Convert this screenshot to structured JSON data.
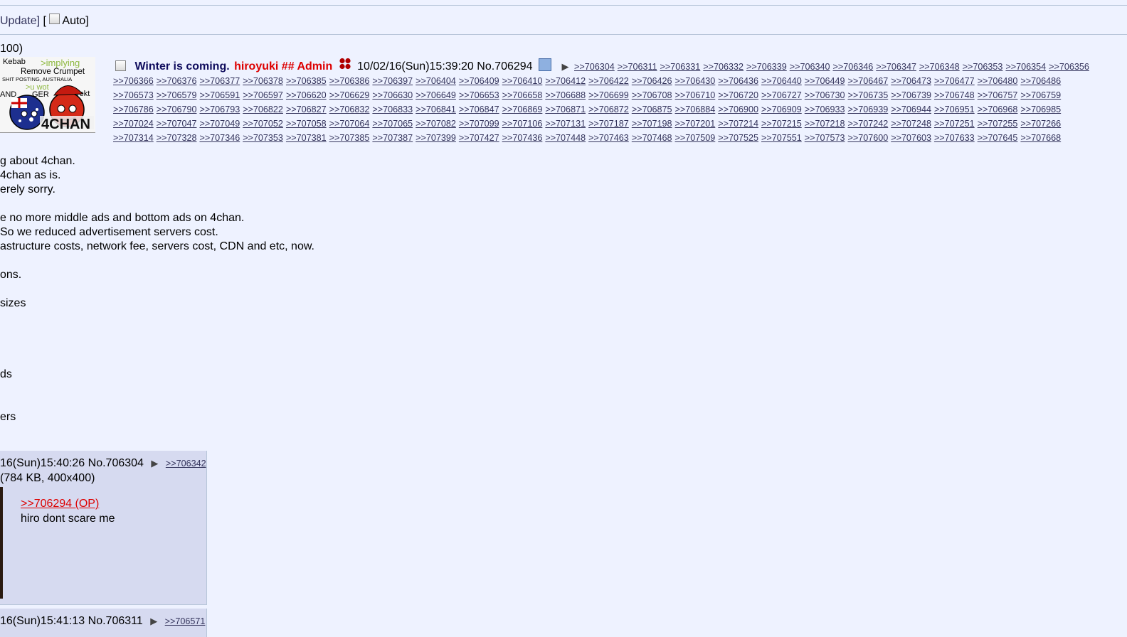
{
  "nav": {
    "update_label": "Update]",
    "open_bracket": " [ ",
    "auto_label": "Auto]"
  },
  "thread": {
    "file_count": "100)",
    "op": {
      "subject": "Winter is coming.",
      "name": "hiroyuki ## Admin",
      "datetime": "10/02/16(Sun)15:39:20",
      "post_no": "No.706294",
      "backlink_rows": [
        [
          ">>706304",
          ">>706311",
          ">>706331",
          ">>706332",
          ">>706339",
          ">>706340",
          ">>706346",
          ">>706347",
          ">>706348",
          ">>706353",
          ">>706354",
          ">>706356"
        ],
        [
          ">>706366",
          ">>706376",
          ">>706377",
          ">>706378",
          ">>706385",
          ">>706386",
          ">>706397",
          ">>706404",
          ">>706409",
          ">>706410",
          ">>706412",
          ">>706422",
          ">>706426",
          ">>706430",
          ">>706436",
          ">>706440",
          ">>706449",
          ">>706467",
          ">>706473",
          ">>706477",
          ">>706480",
          ">>706486"
        ],
        [
          ">>706573",
          ">>706579",
          ">>706591",
          ">>706597",
          ">>706620",
          ">>706629",
          ">>706630",
          ">>706649",
          ">>706653",
          ">>706658",
          ">>706688",
          ">>706699",
          ">>706708",
          ">>706710",
          ">>706720",
          ">>706727",
          ">>706730",
          ">>706735",
          ">>706739",
          ">>706748",
          ">>706757",
          ">>706759"
        ],
        [
          ">>706786",
          ">>706790",
          ">>706793",
          ">>706822",
          ">>706827",
          ">>706832",
          ">>706833",
          ">>706841",
          ">>706847",
          ">>706869",
          ">>706871",
          ">>706872",
          ">>706875",
          ">>706884",
          ">>706900",
          ">>706909",
          ">>706933",
          ">>706939",
          ">>706944",
          ">>706951",
          ">>706968",
          ">>706985"
        ],
        [
          ">>707024",
          ">>707047",
          ">>707049",
          ">>707052",
          ">>707058",
          ">>707064",
          ">>707065",
          ">>707082",
          ">>707099",
          ">>707106",
          ">>707131",
          ">>707187",
          ">>707198",
          ">>707201",
          ">>707214",
          ">>707215",
          ">>707218",
          ">>707242",
          ">>707248",
          ">>707251",
          ">>707255",
          ">>707266"
        ],
        [
          ">>707314",
          ">>707328",
          ">>707346",
          ">>707353",
          ">>707381",
          ">>707385",
          ">>707387",
          ">>707399",
          ">>707427",
          ">>707436",
          ">>707448",
          ">>707463",
          ">>707468",
          ">>707509",
          ">>707525",
          ">>707551",
          ">>707573",
          ">>707600",
          ">>707603",
          ">>707633",
          ">>707645",
          ">>707668"
        ]
      ],
      "message_lines": [
        "g about 4chan.",
        "4chan as is.",
        "erely sorry.",
        "",
        "e no more middle ads and bottom ads on 4chan.",
        "So we reduced advertisement servers cost.",
        "astructure costs, network fee, servers cost, CDN and etc, now.",
        "",
        "ons.",
        "",
        " sizes",
        "",
        "",
        "",
        "",
        "ds",
        "",
        "",
        "ers"
      ]
    },
    "thumbnail": {
      "text_kebab": "Kebab",
      "text_implying": ">implying",
      "text_remove": "Remove Crumpet",
      "text_shitposting": "SHIT POSTING, AUSTRALIA",
      "text_uwot": ">u wot",
      "text_and": "AND",
      "text_ger": "GER",
      "text_rekt": "rekt",
      "text_brand": "4CHAN"
    },
    "replies": [
      {
        "datetime": "16(Sun)15:40:26",
        "post_no": "No.706304",
        "backlink": ">>706342",
        "file_info": "(784 KB, 400x400)",
        "quote": ">>706294 (OP)",
        "text": "hiro dont scare me"
      },
      {
        "datetime": "16(Sun)15:41:13",
        "post_no": "No.706311",
        "backlink": ">>706571"
      }
    ]
  },
  "colors": {
    "background": "#eef2ff",
    "reply_bg": "#d6daf0",
    "subject": "#0f0c5d",
    "admin_name": "#dd0000",
    "link": "#34345c"
  }
}
